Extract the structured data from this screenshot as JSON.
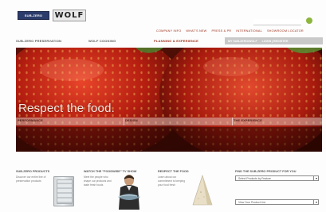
{
  "header": {
    "brand_left": "SUB-ZERO",
    "brand_right": "WOLF",
    "top_links": [
      "COMPANY INFO",
      "WHAT'S NEW",
      "PRESS & PR",
      "INTERNATIONAL",
      "SHOWROOM LOCATOR"
    ],
    "main_nav": [
      "SUB-ZERO PRESERVATION",
      "WOLF COOKING",
      "PLANNING & EXPERIENCE"
    ],
    "search_tab": [
      "MY SUB-ZERO/WOLF",
      "LOGIN | REGISTER"
    ]
  },
  "hero": {
    "headline": "Respect the food.",
    "band": [
      "PERFORMANCE",
      "DESIGN",
      "THE EXPERIENCE"
    ]
  },
  "promos": {
    "p1": {
      "title": "SUB-ZERO PRODUCTS",
      "text": "Discover our entire line of preservation products"
    },
    "p2": {
      "title": "WATCH THE \"FOODWISE\" TV SHOW",
      "text": "Meet the people who shape our products and taste fresh foods"
    },
    "p3": {
      "title": "RESPECT THE FOOD",
      "text": "Learn about our commitment to keeping your food fresh"
    },
    "finder": {
      "title": "FIND THE SUB-ZERO PRODUCT FOR YOU",
      "select1": "Select Products by Feature",
      "select2": "View Your Product List"
    }
  },
  "colors": {
    "accent": "#a0341f",
    "go_button": "#8db63d",
    "nav_tab": "#c9c9c9"
  }
}
